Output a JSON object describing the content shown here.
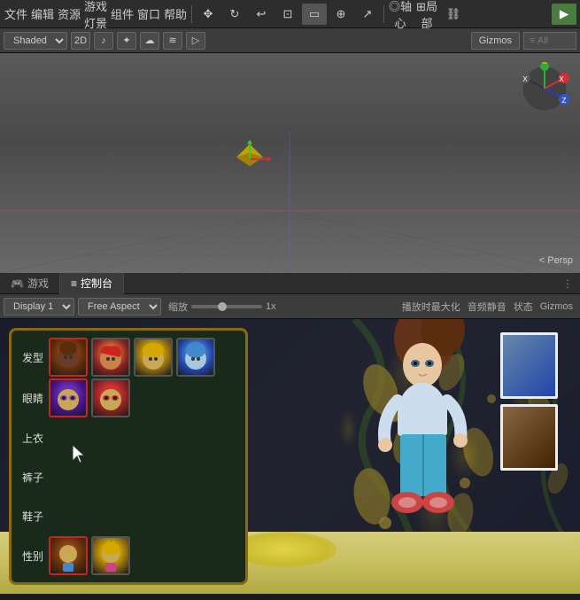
{
  "toolbar": {
    "play_label": "▶",
    "buttons": [
      "≡",
      "⊞",
      "↩",
      "⊡",
      "▭",
      "⊕",
      "↗"
    ],
    "axis_label": "轴心",
    "local_label": "局部",
    "link_label": "⛓"
  },
  "scene_bar": {
    "shading_label": "Shaded",
    "mode_2d": "2D",
    "gizmos_label": "Gizmos",
    "all_placeholder": "≡ All"
  },
  "view_tabs": {
    "game_tab": "游戏",
    "console_tab": "控制台"
  },
  "game_bar": {
    "display_label": "Display 1",
    "aspect_label": "Free Aspect",
    "scale_prefix": "缩放",
    "scale_value": "1x",
    "maximize_label": "播放时最大化",
    "mute_label": "音频静音",
    "status_label": "状态",
    "gizmos_label": "Gizmos"
  },
  "char_panel": {
    "rows": [
      {
        "label": "发型",
        "options": [
          "face-1",
          "face-2",
          "face-3",
          "face-4"
        ],
        "selected": 0
      },
      {
        "label": "眼睛",
        "options": [
          "face-eye-1",
          "face-eye-2"
        ],
        "selected": 0
      },
      {
        "label": "上衣",
        "options": [],
        "selected": -1
      },
      {
        "label": "裤子",
        "options": [],
        "selected": -1
      },
      {
        "label": "鞋子",
        "options": [],
        "selected": -1
      },
      {
        "label": "性别",
        "options": [
          "face-gender-1",
          "face-gender-2"
        ],
        "selected": 0
      }
    ]
  },
  "persp_label": "< Persp"
}
